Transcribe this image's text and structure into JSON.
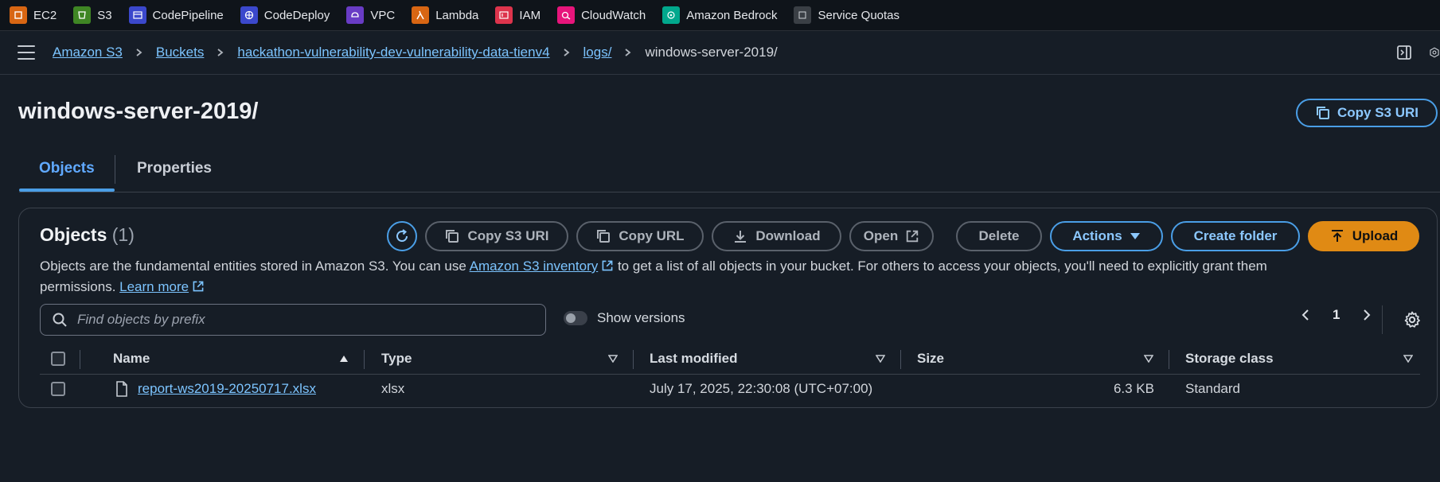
{
  "favorites": [
    {
      "label": "EC2",
      "color": "#d86613",
      "icon": "ec2-icon"
    },
    {
      "label": "S3",
      "color": "#3f8624",
      "icon": "s3-icon"
    },
    {
      "label": "CodePipeline",
      "color": "#3b48cc",
      "icon": "codepipeline-icon"
    },
    {
      "label": "CodeDeploy",
      "color": "#3b48cc",
      "icon": "codedeploy-icon"
    },
    {
      "label": "VPC",
      "color": "#693cc5",
      "icon": "vpc-icon"
    },
    {
      "label": "Lambda",
      "color": "#d86613",
      "icon": "lambda-icon"
    },
    {
      "label": "IAM",
      "color": "#dd344c",
      "icon": "iam-icon"
    },
    {
      "label": "CloudWatch",
      "color": "#e7157b",
      "icon": "cloudwatch-icon"
    },
    {
      "label": "Amazon Bedrock",
      "color": "#01a88d",
      "icon": "bedrock-icon"
    },
    {
      "label": "Service Quotas",
      "color": "#3a3f45",
      "icon": "service-quotas-icon"
    }
  ],
  "breadcrumb": {
    "items": [
      "Amazon S3",
      "Buckets",
      "hackathon-vulnerability-dev-vulnerability-data-tienv4",
      "logs/"
    ],
    "current": "windows-server-2019/"
  },
  "page": {
    "title": "windows-server-2019/",
    "copy_uri_label": "Copy S3 URI"
  },
  "tabs": [
    "Objects",
    "Properties"
  ],
  "objects_panel": {
    "title": "Objects",
    "count": "(1)",
    "buttons": {
      "copy_uri": "Copy S3 URI",
      "copy_url": "Copy URL",
      "download": "Download",
      "open": "Open",
      "delete": "Delete",
      "actions": "Actions",
      "create_folder": "Create folder",
      "upload": "Upload"
    },
    "desc_part1": "Objects are the fundamental entities stored in Amazon S3. You can use ",
    "desc_link1": "Amazon S3 inventory",
    "desc_part2": " to get a list of all objects in your bucket. For others to access your objects, you'll need to explicitly grant them",
    "desc_part3": "permissions. ",
    "desc_link2": "Learn more",
    "search_placeholder": "Find objects by prefix",
    "show_versions": "Show versions",
    "page_number": "1"
  },
  "table": {
    "columns": [
      "Name",
      "Type",
      "Last modified",
      "Size",
      "Storage class"
    ],
    "rows": [
      {
        "name": "report-ws2019-20250717.xlsx",
        "type": "xlsx",
        "last_modified": "July 17, 2025, 22:30:08 (UTC+07:00)",
        "size": "6.3 KB",
        "storage_class": "Standard"
      }
    ]
  },
  "colors": {
    "accent": "#4a9ee6",
    "upload": "#e08a14",
    "link": "#7cc4ff"
  }
}
